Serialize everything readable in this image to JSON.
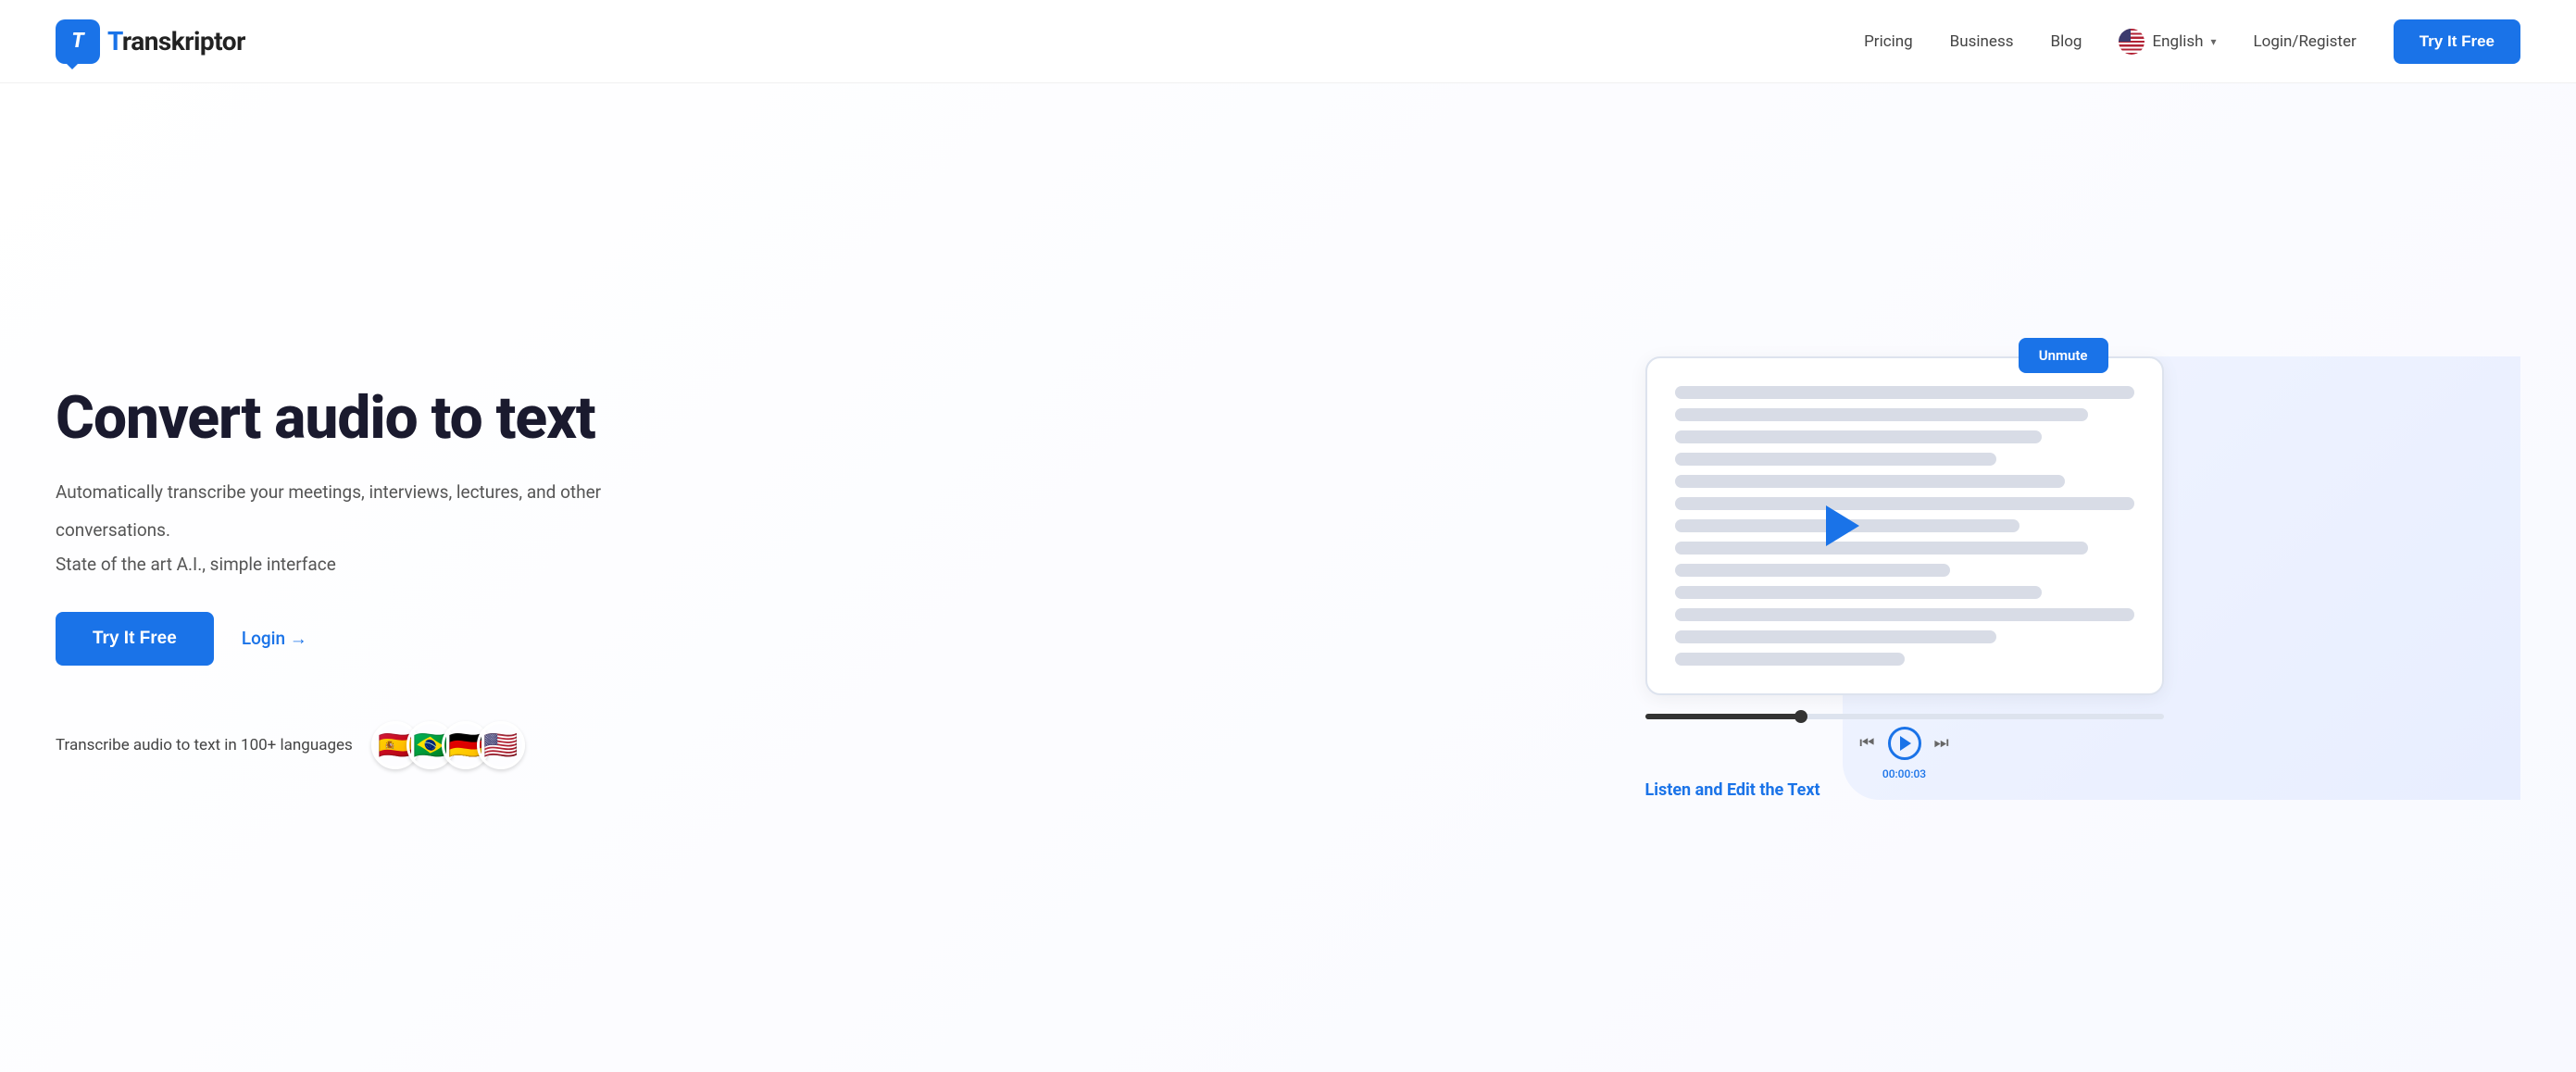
{
  "navbar": {
    "logo_text": "ranskriptor",
    "logo_letter": "T",
    "links": [
      {
        "label": "Pricing",
        "id": "pricing"
      },
      {
        "label": "Business",
        "id": "business"
      },
      {
        "label": "Blog",
        "id": "blog"
      }
    ],
    "language": {
      "label": "English",
      "chevron": "▾"
    },
    "login_label": "Login/Register",
    "try_btn_label": "Try It Free"
  },
  "hero": {
    "title": "Convert audio to text",
    "description1": "Automatically transcribe your meetings, interviews, lectures, and other",
    "description2": "conversations.",
    "description3": "State of the art A.I., simple interface",
    "try_btn_label": "Try It Free",
    "login_label": "Login",
    "login_arrow": "→",
    "languages_text": "Transcribe audio to text in 100+ languages",
    "flags": [
      "🇪🇸",
      "🇧🇷",
      "🇩🇪",
      "🇺🇸"
    ],
    "unmute_label": "Unmute",
    "listen_edit_label": "Listen and Edit the Text",
    "timestamp": "00:00:03"
  }
}
